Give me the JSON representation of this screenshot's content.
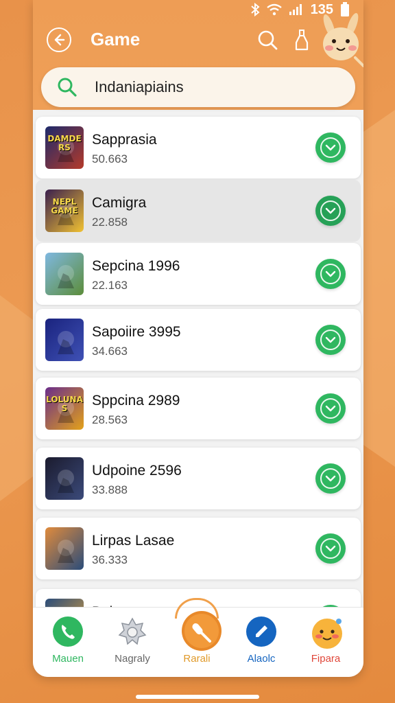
{
  "status": {
    "time": "135"
  },
  "header": {
    "title": "Game"
  },
  "search": {
    "value": "Indaniapiains"
  },
  "items": [
    {
      "title": "Sapprasia",
      "sub": "50.663",
      "thumb_text": "DAMDERS",
      "thumb_colors": [
        "#1d2a6b",
        "#b43a2a"
      ]
    },
    {
      "title": "Camigra",
      "sub": "22.858",
      "thumb_text": "NEPL GAME",
      "thumb_colors": [
        "#3a1f4e",
        "#f1c232"
      ]
    },
    {
      "title": "Sepcina 1996",
      "sub": "22.163",
      "thumb_text": "",
      "thumb_colors": [
        "#7fb8e0",
        "#5c8d3a"
      ]
    },
    {
      "title": "Sapoiire 3995",
      "sub": "34.663",
      "thumb_text": "",
      "thumb_colors": [
        "#1a237e",
        "#3f51b5"
      ]
    },
    {
      "title": "Sppcina 2989",
      "sub": "28.563",
      "thumb_text": "LOLUNAS",
      "thumb_colors": [
        "#6a2d8a",
        "#e3a21a"
      ]
    },
    {
      "title": "Udpoine 2596",
      "sub": "33.888",
      "thumb_text": "",
      "thumb_colors": [
        "#1b1b2e",
        "#3b4a7a"
      ]
    },
    {
      "title": "Lirpas Lasae",
      "sub": "36.333",
      "thumb_text": "",
      "thumb_colors": [
        "#e08b3c",
        "#2a4c7a"
      ]
    },
    {
      "title": "Bois",
      "sub": "",
      "thumb_text": "",
      "thumb_colors": [
        "#2a4c7a",
        "#e0a23c"
      ]
    }
  ],
  "nav": [
    {
      "label": "Mauen",
      "color": "#2fb760",
      "icon": "phone-icon"
    },
    {
      "label": "Nagraly",
      "color": "#666666",
      "icon": "badge-icon"
    },
    {
      "label": "Rarali",
      "color": "#e09a2a",
      "icon": "microphone-icon"
    },
    {
      "label": "Alaolc",
      "color": "#1565c0",
      "icon": "pen-icon"
    },
    {
      "label": "Fipara",
      "color": "#e0473a",
      "icon": "smiley-icon"
    }
  ],
  "colors": {
    "accent": "#ee9d55",
    "check": "#2fb760"
  }
}
